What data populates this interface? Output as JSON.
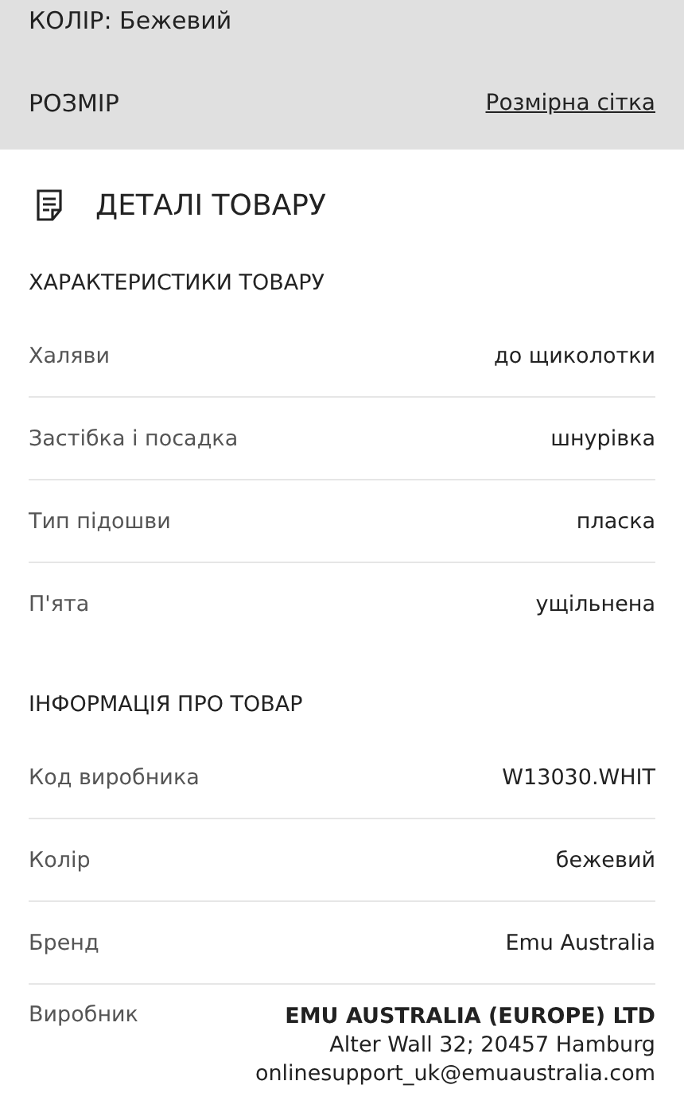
{
  "selection": {
    "color_label": "КОЛІР: Бежевий",
    "size_label": "РОЗМІР",
    "size_chart_link": "Розмірна сітка"
  },
  "details": {
    "title": "ДЕТАЛІ ТОВАРУ",
    "sections": [
      {
        "heading": "ХАРАКТЕРИСТИКИ ТОВАРУ",
        "rows": [
          {
            "label": "Халяви",
            "lines": [
              {
                "text": "до щиколотки",
                "strong": false
              }
            ]
          },
          {
            "label": "Застібка і посадка",
            "lines": [
              {
                "text": "шнурівка",
                "strong": false
              }
            ]
          },
          {
            "label": "Тип підошви",
            "lines": [
              {
                "text": "пласка",
                "strong": false
              }
            ]
          },
          {
            "label": "П'ята",
            "lines": [
              {
                "text": "ущільнена",
                "strong": false
              }
            ]
          }
        ]
      },
      {
        "heading": "ІНФОРМАЦІЯ ПРО ТОВАР",
        "rows": [
          {
            "label": "Код виробника",
            "lines": [
              {
                "text": "W13030.WHIT",
                "strong": false
              }
            ]
          },
          {
            "label": "Колір",
            "lines": [
              {
                "text": "бежевий",
                "strong": false
              }
            ]
          },
          {
            "label": "Бренд",
            "lines": [
              {
                "text": "Emu Australia",
                "strong": false
              }
            ]
          },
          {
            "label": "Виробник",
            "lines": [
              {
                "text": "EMU AUSTRALIA (EUROPE) LTD",
                "strong": true
              },
              {
                "text": "Alter Wall 32; 20457 Hamburg",
                "strong": false
              },
              {
                "text": "onlinesupport_uk@emuaustralia.com",
                "strong": false
              }
            ]
          }
        ]
      }
    ]
  }
}
